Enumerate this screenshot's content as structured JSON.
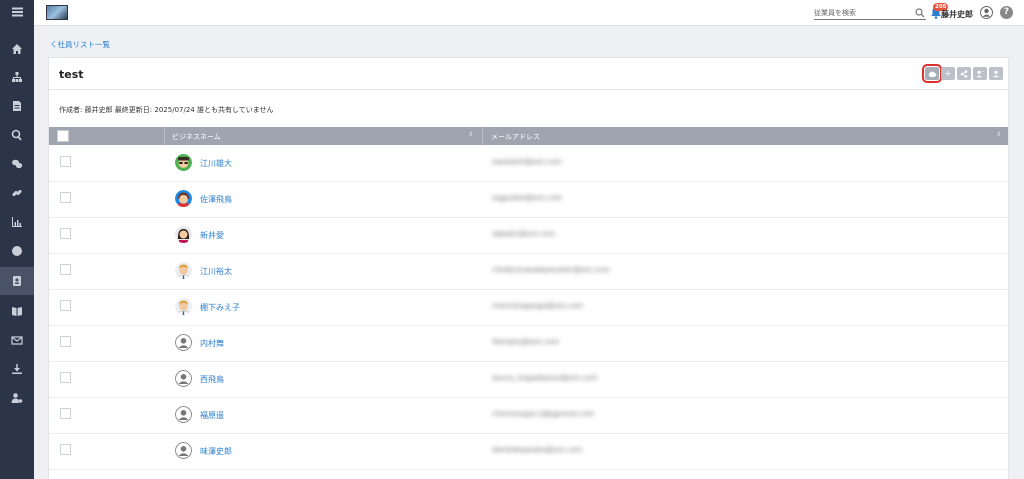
{
  "header": {
    "search_placeholder": "従業員を検索",
    "notification_count": "205",
    "username": "藤井史郎",
    "help": "?"
  },
  "breadcrumb": "く社員リスト一覧",
  "list": {
    "title": "test",
    "meta": "作成者: 藤井史郎  最終更新日: 2025/07/24  誰とも共有していません",
    "columns": [
      "ビジネスネーム",
      "メールアドレス"
    ],
    "rows": [
      {
        "name": "江川雄大",
        "email": "ewadashi@ezn.com",
        "avatar": "green-glasses"
      },
      {
        "name": "佐澤飛鳥",
        "email": "ssgpadoe@ezn.com",
        "avatar": "blue-woman"
      },
      {
        "name": "新井愛",
        "email": "adjader@ezn.com",
        "avatar": "woman-dark"
      },
      {
        "name": "江川裕太",
        "email": "chiefpckswadepesotter@ezn.com",
        "avatar": "man-blond"
      },
      {
        "name": "棚下みえ子",
        "email": "mieoristagaogo@ezn.com",
        "avatar": "man-blond"
      },
      {
        "name": "内村舞",
        "email": "fdsmpha@ezn.com",
        "avatar": "default"
      },
      {
        "name": "西飛鳥",
        "email": "asuna_nisgadepsue@ezn.com",
        "avatar": "default"
      },
      {
        "name": "福原遥",
        "email": "chiemeaspw.1@pgemail.com",
        "avatar": "default"
      },
      {
        "name": "味澤史郎",
        "email": "dwrikdeepodee@ezn.com",
        "avatar": "default"
      }
    ]
  },
  "colors": {
    "sidebar": "#2c3448",
    "accent": "#2a7fd1",
    "table_header": "#9ea4b0",
    "highlight": "#d9302c"
  }
}
